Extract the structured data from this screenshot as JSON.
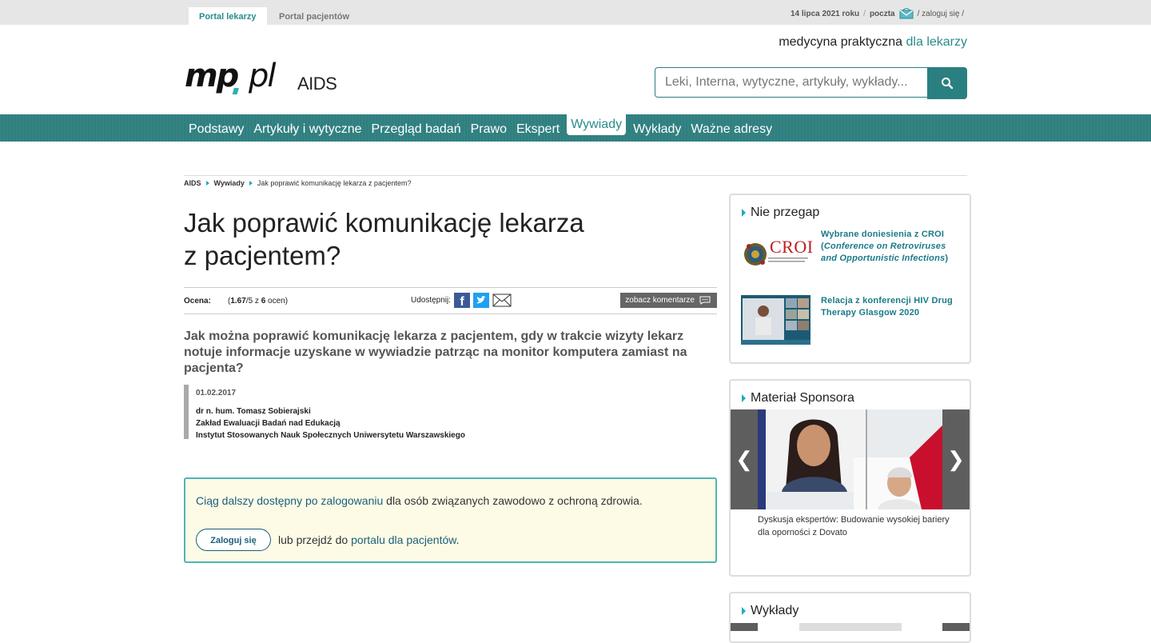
{
  "topbar": {
    "tab_doctors": "Portal lekarzy",
    "tab_patients": "Portal pacjentów",
    "date": "14 lipca 2021 roku",
    "sep1": "/",
    "mail": "poczta",
    "login": "/ zaloguj się /"
  },
  "header": {
    "tagline_main": "medycyna praktyczna ",
    "tagline_accent": "dla lekarzy",
    "logo_text": "mp.pl",
    "section": "AIDS",
    "search_placeholder": "Leki, Interna, wytyczne, artykuły, wykłady..."
  },
  "nav": {
    "items": [
      "Podstawy",
      "Artykuły i wytyczne",
      "Przegląd badań",
      "Prawo",
      "Ekspert",
      "Wywiady",
      "Wykłady",
      "Ważne adresy"
    ],
    "active": "Wywiady"
  },
  "breadcrumb": [
    "AIDS",
    "Wywiady",
    "Jak poprawić komunikację lekarza z pacjentem?"
  ],
  "article": {
    "title_l1": "Jak poprawić komunikację lekarza",
    "title_l2": "z pacjentem?",
    "rating_label": "Ocena:",
    "rating_open": "(",
    "rating_score": "1.67",
    "rating_mid": "/5 z ",
    "rating_count": "6",
    "rating_end": " ocen)",
    "share_label": "Udostępnij:",
    "comments_btn": "zobacz komentarze",
    "lead": "Jak można poprawić komunikację lekarza z pacjentem, gdy w trakcie wizyty lekarz notuje informacje uzyskane w wywiadzie patrząc na monitor komputera zamiast na pacjenta?",
    "date": "01.02.2017",
    "author_1": "dr n. hum. Tomasz Sobierajski",
    "author_2": "Zakład Ewaluacji Badań nad Edukacją",
    "author_3": "Instytut Stosowanych Nauk Społecznych Uniwersytetu Warszawskiego"
  },
  "login_box": {
    "link1": "Ciąg dalszy dostępny po zalogowaniu",
    "text1": " dla osób związanych zawodowo z ochroną zdrowia.",
    "button": "Zaloguj się",
    "text2": "lub przejdź do ",
    "link2": "portalu dla pacjentów",
    "dot": "."
  },
  "sidebar": {
    "box1_title": "Nie przegap",
    "news1_a": "Wybrane doniesienia z CROI (",
    "news1_i": "Conference on Retroviruses and Opportunistic Infections",
    "news1_b": ")",
    "news1_logo": "CROI",
    "news2": "Relacja z konferencji HIV Drug Therapy Glasgow 2020",
    "box2_title": "Materiał Sponsora",
    "prev": "❮",
    "next": "❯",
    "caption": "Dyskusja ekspertów: Budowanie wysokiej bariery dla oporności z Dovato",
    "box3_title": "Wykłady"
  },
  "colors": {
    "accent": "#2a8c8c",
    "nav_bg": "#2f7f80",
    "link": "#1a7a88",
    "login_border": "#4ab6b8"
  }
}
